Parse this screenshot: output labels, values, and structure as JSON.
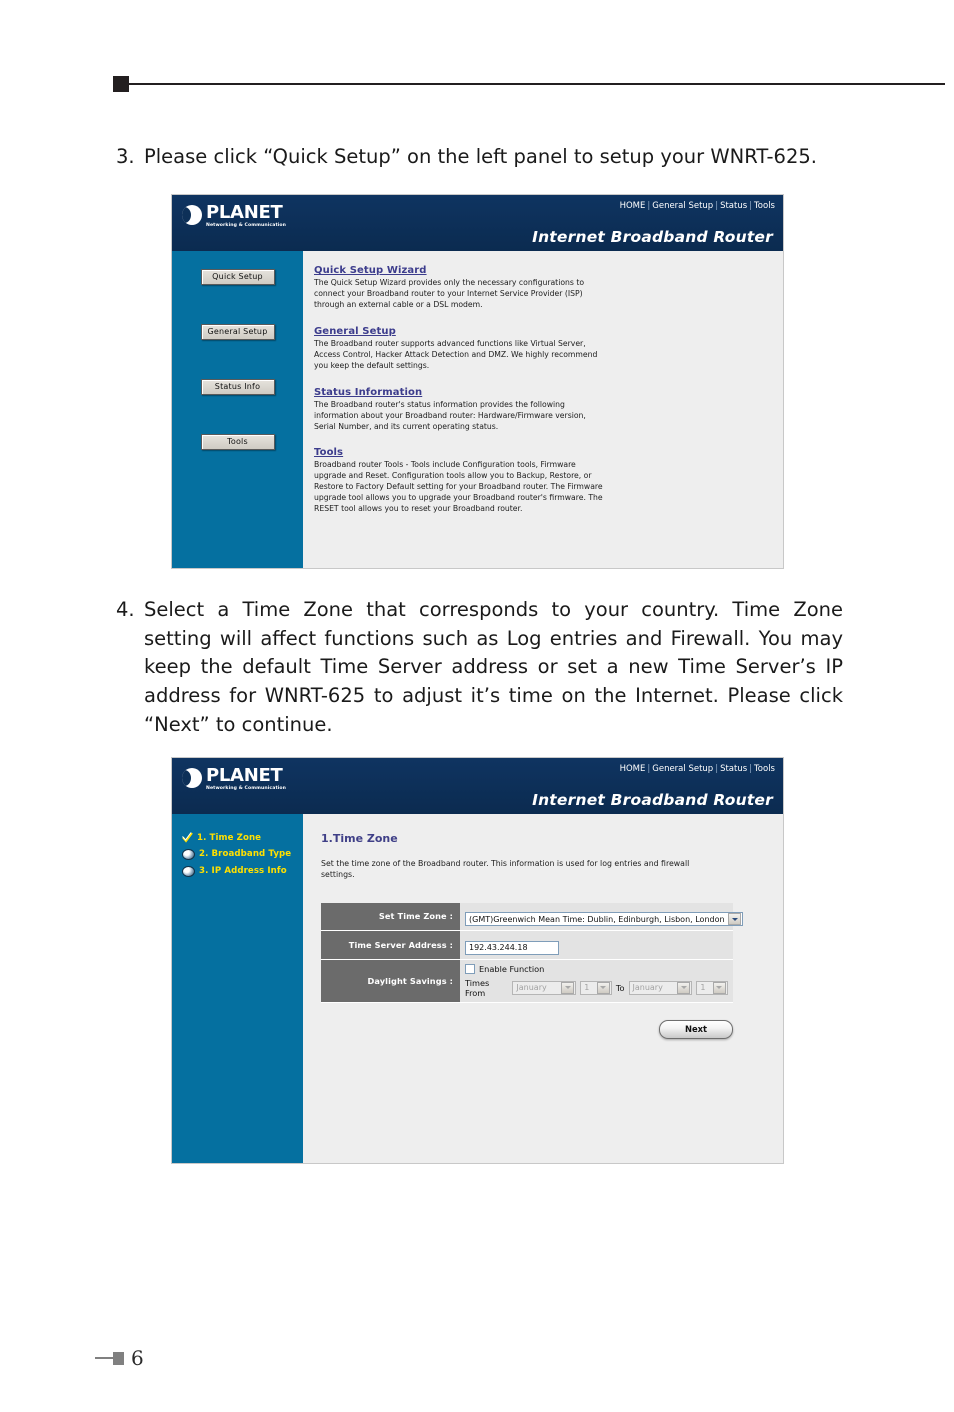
{
  "page": {
    "number": "6"
  },
  "steps": [
    {
      "num": "3.",
      "text": "Please click “Quick Setup” on the left panel to setup your WNRT-625."
    },
    {
      "num": "4.",
      "text": "Select a Time Zone that corresponds to your country. Time Zone setting will affect functions such as Log entries and Firewall. You may keep the default Time Server address or set a new Time Server’s IP address for WNRT-625 to adjust it’s time on the Internet. Please click “Next” to continue."
    }
  ],
  "router_ui": {
    "brand": {
      "name": "PLANET",
      "tagline": "Networking & Communication",
      "logo_icon": "planet-globe-icon"
    },
    "product_title": "Internet Broadband Router",
    "nav": [
      "HOME",
      "General Setup",
      "Status",
      "Tools"
    ],
    "nav_separator": "|",
    "colors": {
      "header_blue": "#0d3058",
      "sidebar_blue": "#0570a0",
      "content_gray": "#eeeeee",
      "label_gray": "#6b6b6b",
      "link_purple": "#3c3c8c",
      "wizard_yellow": "#ffe000"
    }
  },
  "screen_home": {
    "sidebar_buttons": [
      "Quick Setup",
      "General Setup",
      "Status Info",
      "Tools"
    ],
    "sections": [
      {
        "title": "Quick Setup Wizard",
        "desc": "The Quick Setup Wizard provides only the necessary configurations to connect your Broadband router to your Internet Service Provider (ISP) through an external cable or a DSL modem."
      },
      {
        "title": "General Setup",
        "desc": "The Broadband router supports advanced functions like Virtual Server, Access Control, Hacker Attack Detection and DMZ. We highly recommend you keep the default settings."
      },
      {
        "title": "Status Information",
        "desc": "The Broadband router's status information provides the following information about your Broadband router: Hardware/Firmware version, Serial Number, and its current operating status."
      },
      {
        "title": "Tools",
        "desc": "Broadband router Tools - Tools include Configuration tools, Firmware upgrade and Reset. Configuration tools allow you to Backup, Restore, or Restore to Factory Default setting for your Broadband router. The Firmware upgrade tool allows you to upgrade your Broadband router's firmware. The RESET tool allows you to reset your Broadband router."
      }
    ]
  },
  "screen_timezone": {
    "wizard_steps": [
      {
        "label": "1. Time Zone",
        "icon": "check-icon",
        "state": "current"
      },
      {
        "label": "2. Broadband Type",
        "icon": "bullet-icon",
        "state": "pending"
      },
      {
        "label": "3. IP Address Info",
        "icon": "bullet-icon",
        "state": "pending"
      }
    ],
    "heading": "1.Time Zone",
    "description": "Set the time zone of the Broadband router. This information is used for log entries and firewall settings.",
    "fields": {
      "time_zone_label": "Set Time Zone :",
      "time_zone_value": "(GMT)Greenwich Mean Time: Dublin, Edinburgh, Lisbon, London",
      "time_server_label": "Time Server Address :",
      "time_server_value": "192.43.244.18",
      "daylight_label": "Daylight Savings :",
      "enable_function_label": "Enable Function",
      "enable_function_checked": false,
      "times_from_label": "Times From",
      "from_month": "January",
      "from_day": "1",
      "to_label": "To",
      "to_month": "January",
      "to_day": "1"
    },
    "next_button": "Next"
  }
}
